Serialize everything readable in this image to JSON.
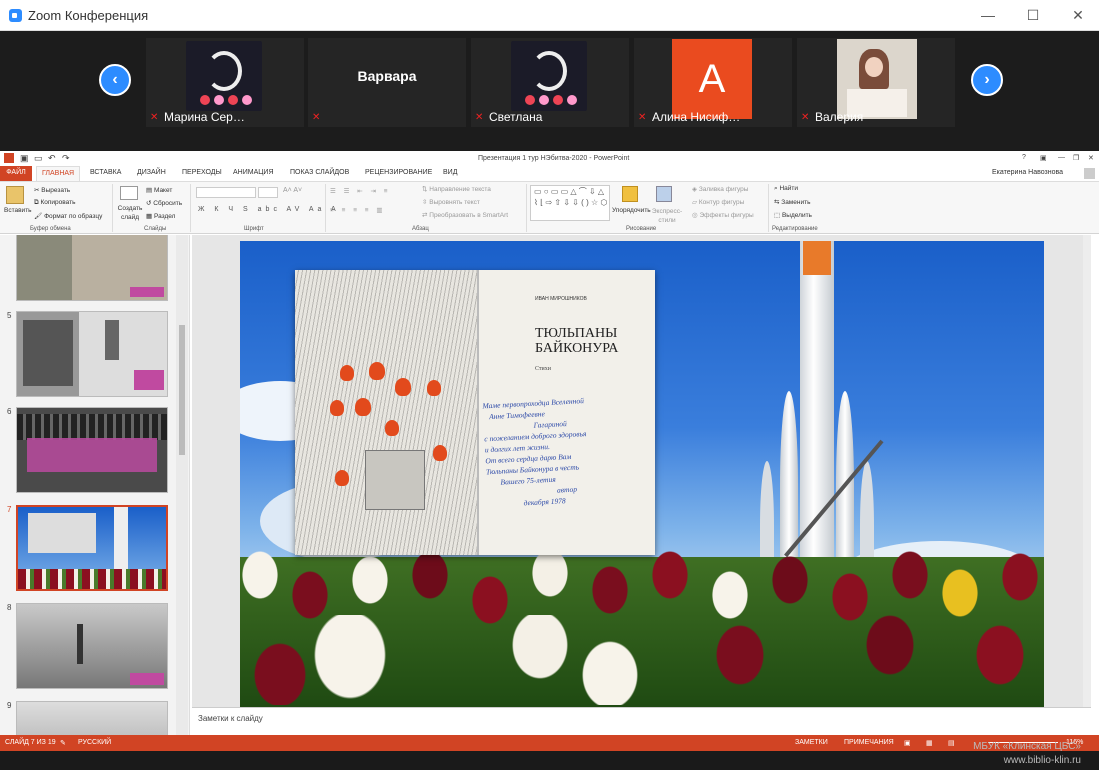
{
  "window": {
    "title": "Zoom Конференция"
  },
  "participants": [
    {
      "name": "Марина Сер…",
      "type": "unicorn"
    },
    {
      "name": "Варвара",
      "type": "name_only"
    },
    {
      "name": "Светлана",
      "type": "unicorn"
    },
    {
      "name": "Алина Нисиф…",
      "type": "letter",
      "letter": "А",
      "color": "#ea4b1f"
    },
    {
      "name": "Валерия",
      "type": "photo"
    }
  ],
  "ppt": {
    "doc_title": "Презентация 1 тур НЭбитва-2020 - PowerPoint",
    "file_tab": "ФАЙЛ",
    "tabs": [
      "ГЛАВНАЯ",
      "ВСТАВКА",
      "ДИЗАЙН",
      "ПЕРЕХОДЫ",
      "АНИМАЦИЯ",
      "ПОКАЗ СЛАЙДОВ",
      "РЕЦЕНЗИРОВАНИЕ",
      "ВИД"
    ],
    "user": "Екатерина Навознова",
    "ribbon": {
      "paste": "Вставить",
      "cut": "Вырезать",
      "copy": "Копировать",
      "format_painter": "Формат по образцу",
      "clipboard": "Буфер обмена",
      "new_slide": "Создать слайд",
      "layout": "Макет",
      "reset": "Сбросить",
      "section": "Раздел",
      "slides": "Слайды",
      "font": "Шрифт",
      "text_direction": "Направление текста",
      "align_text": "Выровнять текст",
      "smartart": "Преобразовать в SmartArt",
      "paragraph": "Абзац",
      "arrange": "Упорядочить",
      "quick_styles": "Экспресс-стили",
      "shape_fill": "Заливка фигуры",
      "shape_outline": "Контур фигуры",
      "shape_effects": "Эффекты фигуры",
      "drawing": "Рисование",
      "find": "Найти",
      "replace": "Заменить",
      "select": "Выделить",
      "editing": "Редактирование"
    },
    "thumb_numbers": [
      "5",
      "6",
      "7",
      "8",
      "9"
    ],
    "notes_placeholder": "Заметки к слайду",
    "status": {
      "slide_info": "СЛАЙД 7 ИЗ 19",
      "language": "РУССКИЙ",
      "notes": "ЗАМЕТКИ",
      "comments": "ПРИМЕЧАНИЯ",
      "zoom": "116%"
    }
  },
  "book": {
    "author": "ИВАН МИРОШНИКОВ",
    "title_line1": "ТЮЛЬПАНЫ",
    "title_line2": "БАЙКОНУРА",
    "subtitle": "Стихи",
    "handwriting": [
      "Маме первопроходца Вселенной",
      "Анне Тимофеевне",
      "Гагариной",
      "с пожеланием доброго здоровья",
      "и долгих лет жизни.",
      "От всего сердца дарю Вам",
      "Тюльпаны Байконура в честь",
      "Вашего 75-летия",
      "автор",
      "декабря 1978"
    ]
  },
  "watermark": {
    "line1": "МБУК «Клинская ЦБС»",
    "line2": "www.biblio-klin.ru"
  }
}
